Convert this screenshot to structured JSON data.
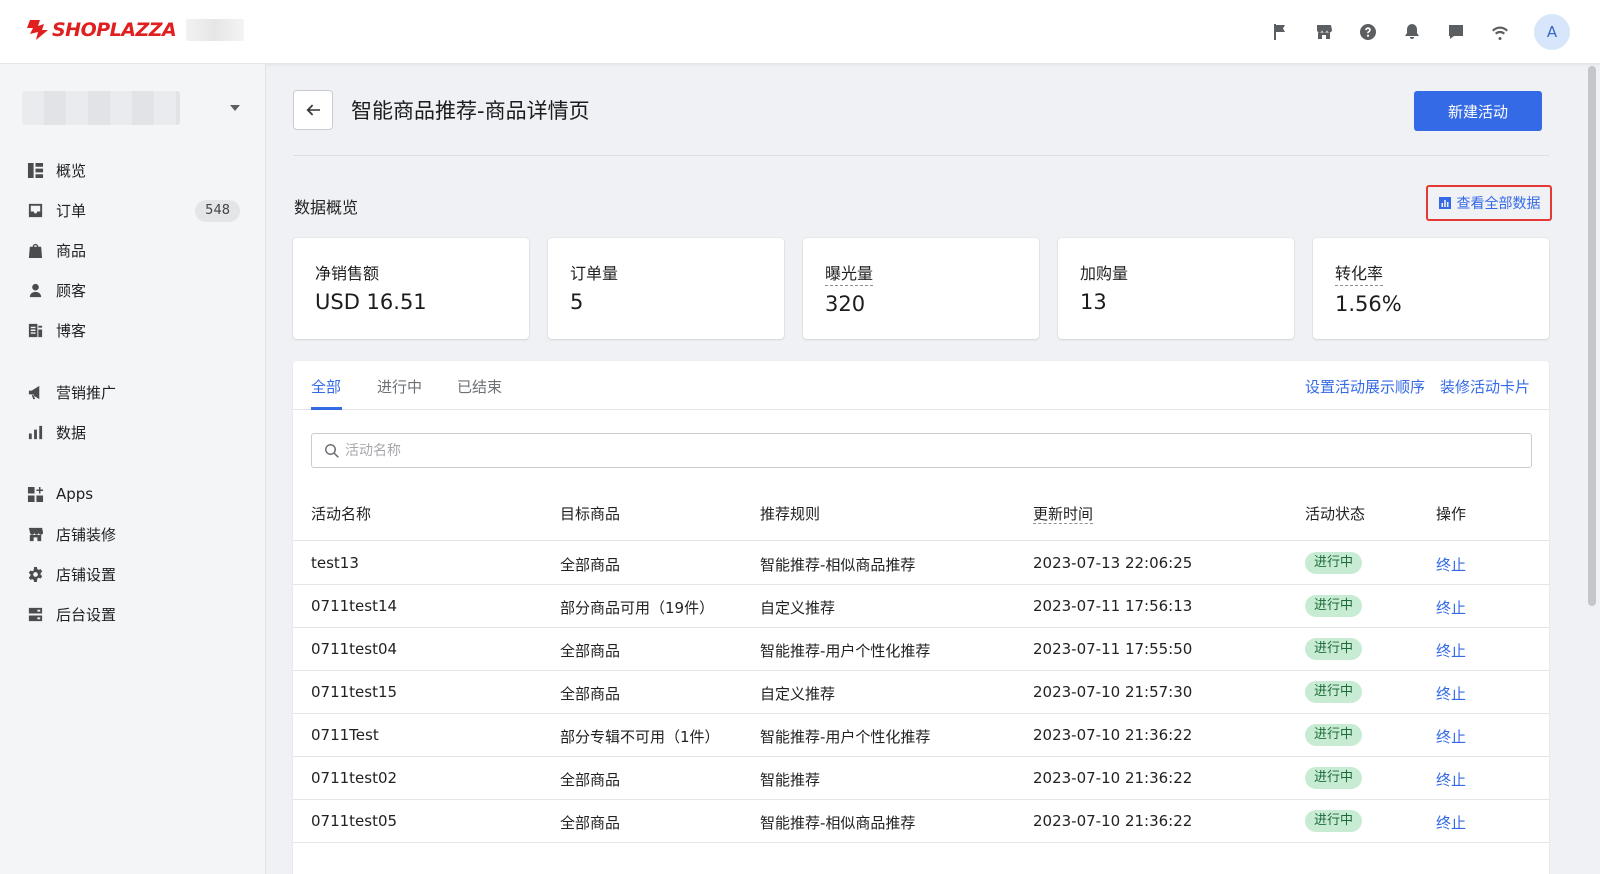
{
  "brand": {
    "name": "SHOPLAZZA",
    "color": "#e02020"
  },
  "topbar": {
    "icons": [
      "flag-icon",
      "store-icon",
      "help-icon",
      "bell-icon",
      "chat-icon",
      "wifi-icon"
    ],
    "avatar_letter": "A"
  },
  "sidebar": {
    "items": [
      {
        "label": "概览",
        "icon": "overview-icon"
      },
      {
        "label": "订单",
        "icon": "inbox-icon",
        "badge": "548"
      },
      {
        "label": "商品",
        "icon": "bag-icon"
      },
      {
        "label": "顾客",
        "icon": "person-icon"
      },
      {
        "label": "博客",
        "icon": "blog-icon"
      },
      {
        "label": "营销推广",
        "icon": "megaphone-icon"
      },
      {
        "label": "数据",
        "icon": "bar-chart-icon"
      },
      {
        "label": "Apps",
        "icon": "apps-icon"
      },
      {
        "label": "店铺装修",
        "icon": "store-icon"
      },
      {
        "label": "店铺设置",
        "icon": "gear-icon"
      },
      {
        "label": "后台设置",
        "icon": "server-icon"
      }
    ]
  },
  "header": {
    "title": "智能商品推荐-商品详情页",
    "primary_button": "新建活动"
  },
  "overview": {
    "title": "数据概览",
    "view_all": "查看全部数据",
    "stats": [
      {
        "label": "净销售额",
        "value": "USD 16.51",
        "dotted": false
      },
      {
        "label": "订单量",
        "value": "5",
        "dotted": false
      },
      {
        "label": "曝光量",
        "value": "320",
        "dotted": true
      },
      {
        "label": "加购量",
        "value": "13",
        "dotted": false
      },
      {
        "label": "转化率",
        "value": "1.56%",
        "dotted": true
      }
    ]
  },
  "tabs": {
    "items": [
      "全部",
      "进行中",
      "已结束"
    ],
    "active": "全部",
    "links": [
      "设置活动展示顺序",
      "装修活动卡片"
    ]
  },
  "search": {
    "placeholder": "活动名称"
  },
  "table": {
    "headers": [
      "活动名称",
      "目标商品",
      "推荐规则",
      "更新时间",
      "活动状态",
      "操作"
    ],
    "rows": [
      {
        "name": "test13",
        "target": "全部商品",
        "rule": "智能推荐-相似商品推荐",
        "time": "2023-07-13 22:06:25",
        "status": "进行中",
        "action": "终止"
      },
      {
        "name": "0711test14",
        "target": "部分商品可用（19件）",
        "rule": "自定义推荐",
        "time": "2023-07-11 17:56:13",
        "status": "进行中",
        "action": "终止"
      },
      {
        "name": "0711test04",
        "target": "全部商品",
        "rule": "智能推荐-用户个性化推荐",
        "time": "2023-07-11 17:55:50",
        "status": "进行中",
        "action": "终止"
      },
      {
        "name": "0711test15",
        "target": "全部商品",
        "rule": "自定义推荐",
        "time": "2023-07-10 21:57:30",
        "status": "进行中",
        "action": "终止"
      },
      {
        "name": "0711Test",
        "target": "部分专辑不可用（1件）",
        "rule": "智能推荐-用户个性化推荐",
        "time": "2023-07-10 21:36:22",
        "status": "进行中",
        "action": "终止"
      },
      {
        "name": "0711test02",
        "target": "全部商品",
        "rule": "智能推荐",
        "time": "2023-07-10 21:36:22",
        "status": "进行中",
        "action": "终止"
      },
      {
        "name": "0711test05",
        "target": "全部商品",
        "rule": "智能推荐-相似商品推荐",
        "time": "2023-07-10 21:36:22",
        "status": "进行中",
        "action": "终止"
      }
    ]
  },
  "colors": {
    "accent": "#356ae6",
    "status_bg": "#c8ecd3",
    "status_text": "#1c6a3a",
    "highlight_border": "#e53935"
  }
}
